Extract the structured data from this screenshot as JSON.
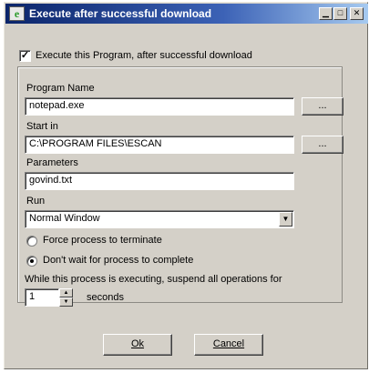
{
  "window": {
    "title": "Execute after successful download",
    "app_icon_glyph": "e",
    "controls": {
      "minimize": "▁",
      "maximize": "□",
      "close": "✕"
    }
  },
  "execute_checkbox": {
    "label": "Execute this Program, after successful download",
    "checked": true,
    "mark": "✓"
  },
  "program_name": {
    "label": "Program Name",
    "value": "notepad.exe",
    "browse_label": "..."
  },
  "start_in": {
    "label": "Start in",
    "value": "C:\\PROGRAM FILES\\ESCAN",
    "browse_label": "..."
  },
  "parameters": {
    "label": "Parameters",
    "value": "govind.txt"
  },
  "run": {
    "label": "Run",
    "selected": "Normal Window",
    "arrow": "▼"
  },
  "radios": [
    {
      "label": "Force process to terminate",
      "selected": false
    },
    {
      "label": "Don't wait for process to complete",
      "selected": true
    }
  ],
  "suspend": {
    "label": "While this process is executing, suspend all operations for",
    "value": "1",
    "unit": "seconds",
    "up": "▲",
    "down": "▼"
  },
  "buttons": {
    "ok": "Ok",
    "cancel": "Cancel"
  }
}
